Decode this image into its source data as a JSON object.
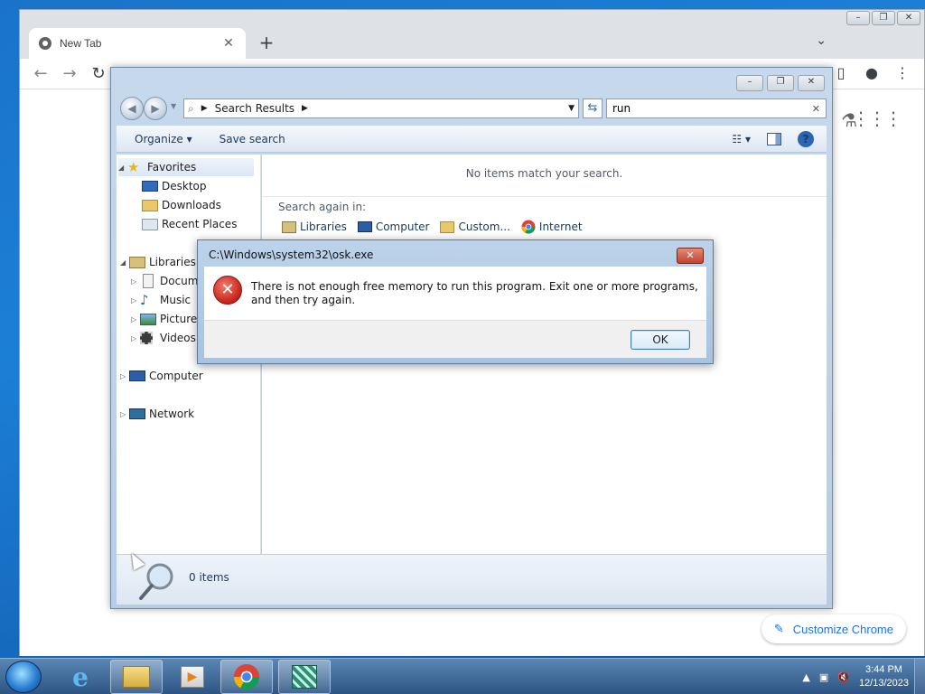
{
  "chrome": {
    "tab_title": "New Tab",
    "tab_close": "✕",
    "new_tab": "+",
    "customize_label": "Customize Chrome"
  },
  "explorer": {
    "breadcrumb": "Search Results",
    "search_value": "run",
    "commands": {
      "organize": "Organize",
      "save_search": "Save search"
    },
    "nav": {
      "favorites": "Favorites",
      "desktop": "Desktop",
      "downloads": "Downloads",
      "recent_places": "Recent Places",
      "libraries": "Libraries",
      "documents": "Docum",
      "music": "Music",
      "pictures": "Picture",
      "videos": "Videos",
      "computer": "Computer",
      "network": "Network"
    },
    "content": {
      "empty_message": "No items match your search.",
      "search_again": "Search again in:",
      "locations": [
        "Libraries",
        "Computer",
        "Custom...",
        "Internet"
      ]
    },
    "details": {
      "count": "0 items"
    }
  },
  "dialog": {
    "title": "C:\\Windows\\system32\\osk.exe",
    "message": "There is not enough free memory to run this program. Exit one or more programs, and then try again.",
    "ok_label": "OK"
  },
  "taskbar": {
    "time": "3:44 PM",
    "date": "12/13/2023"
  },
  "colors": {
    "accent": "#1a73e8",
    "error_red": "#c4221a",
    "taskbar": "#2d5583"
  }
}
